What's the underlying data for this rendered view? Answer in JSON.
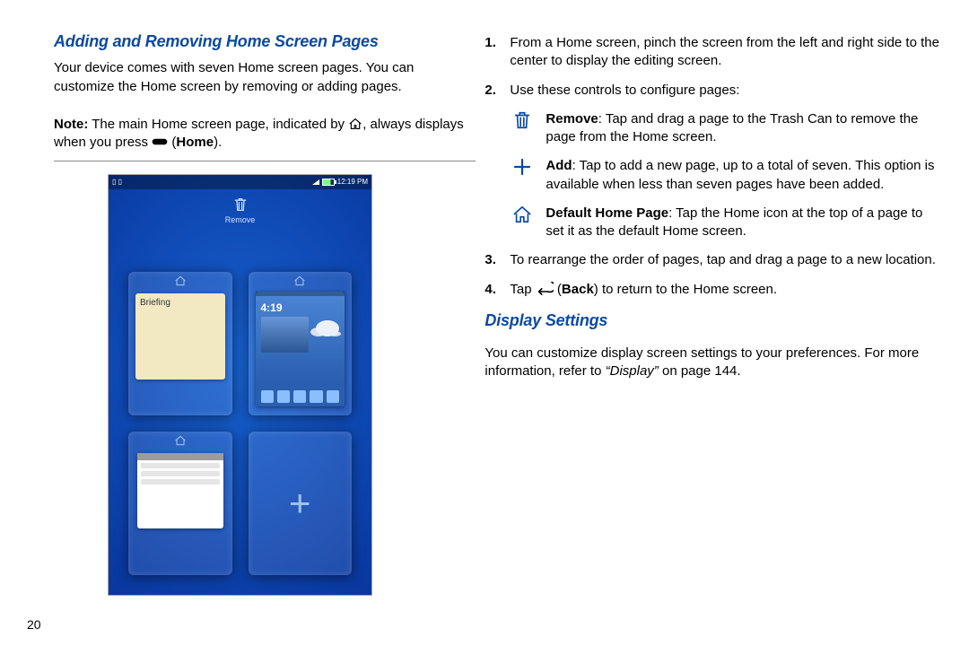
{
  "left": {
    "heading": "Adding and Removing Home Screen Pages",
    "intro": "Your device comes with seven Home screen pages. You can customize the Home screen by removing or adding pages.",
    "note": {
      "label": "Note:",
      "part1": " The main Home screen page, indicated by ",
      "part2": ", always displays when you press ",
      "home_btn_label": "Home",
      "close_paren": ")"
    },
    "page_number": "20",
    "screenshot": {
      "status_time": "12:19 PM",
      "trash_label": "Remove",
      "tile_briefing_label": "Briefing",
      "tile_home_time": "4:19",
      "add_symbol": "+"
    }
  },
  "right": {
    "step1": "From a Home screen, pinch the screen from the left and right side to the center to display the editing screen.",
    "step2": "Use these controls to configure pages:",
    "defs": {
      "remove_label": "Remove",
      "remove_text": ": Tap and drag a page to the Trash Can to remove the page from the Home screen.",
      "add_label": "Add",
      "add_text": ": Tap to add a new page, up to a total of seven. This option is available when less than seven pages have been added.",
      "default_label": "Default Home Page",
      "default_text": ": Tap the Home icon at the top of a page to set it as the default Home screen."
    },
    "step3": "To rearrange the order of pages, tap and drag a page to a new location.",
    "step4_a": "Tap ",
    "step4_back_label": "Back",
    "step4_b": ") to return to the Home screen.",
    "display_heading": "Display Settings",
    "display_body_a": "You can customize display screen settings to your preferences. For more information, refer to ",
    "display_body_ref": "“Display”",
    "display_body_b": " on page 144."
  }
}
